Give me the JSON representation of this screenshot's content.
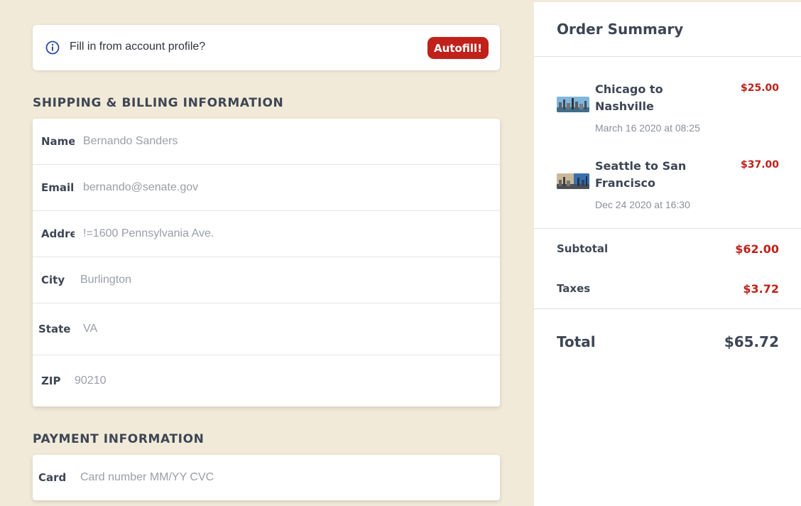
{
  "banner": {
    "text": "Fill in from account profile?",
    "button_label": "Autofill!"
  },
  "shipping": {
    "title": "SHIPPING & BILLING INFORMATION",
    "fields": [
      {
        "label": "Name",
        "value": "Bernando Sanders"
      },
      {
        "label": "Email",
        "value": "bernando@senate.gov"
      },
      {
        "label": "Address",
        "value": "!=1600 Pennsylvania Ave."
      },
      {
        "label": "City",
        "value": "Burlington"
      },
      {
        "label": "State",
        "value": "VA"
      },
      {
        "label": "ZIP",
        "value": "90210"
      }
    ]
  },
  "payment": {
    "title": "PAYMENT INFORMATION",
    "card_label": "Card",
    "card_placeholder": "Card number MM/YY CVC"
  },
  "summary": {
    "title": "Order Summary",
    "items": [
      {
        "name": "Chicago to Nashville",
        "date": "March 16 2020 at 08:25",
        "price": "$25.00"
      },
      {
        "name": "Seattle to San Francisco",
        "date": "Dec 24 2020 at 16:30",
        "price": "$37.00"
      }
    ],
    "subtotal_label": "Subtotal",
    "subtotal_value": "$62.00",
    "taxes_label": "Taxes",
    "taxes_value": "$3.72",
    "total_label": "Total",
    "total_value": "$65.72"
  },
  "colors": {
    "background": "#f2ead8",
    "accent": "#c0211a",
    "text": "#3d4655",
    "info_icon": "#2b4aa6"
  }
}
